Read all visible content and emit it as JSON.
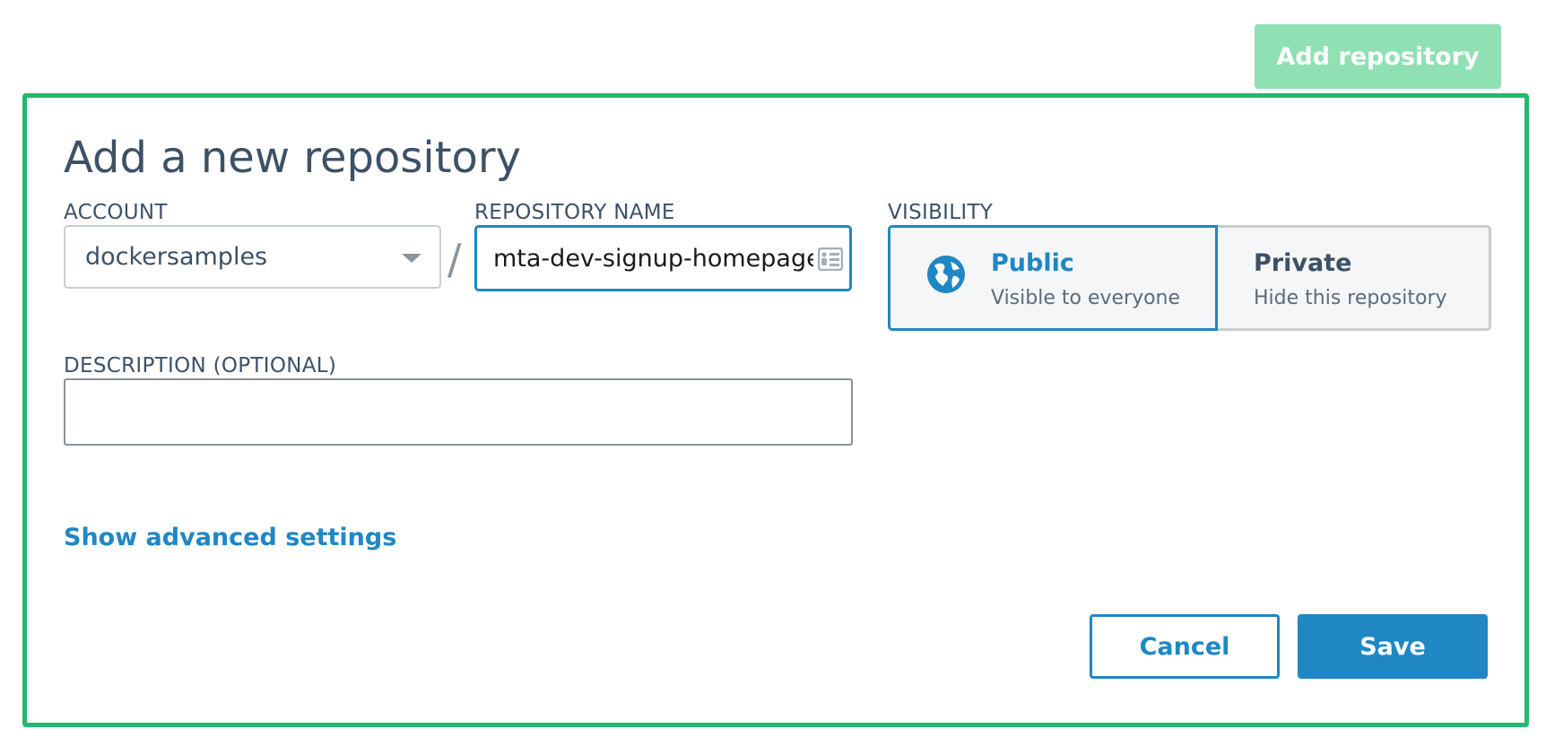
{
  "header": {
    "add_repository_label": "Add repository"
  },
  "form": {
    "title": "Add a new repository",
    "account": {
      "label": "ACCOUNT",
      "selected": "dockersamples"
    },
    "separator": "/",
    "repository_name": {
      "label": "REPOSITORY NAME",
      "value": "mta-dev-signup-homepage"
    },
    "visibility": {
      "label": "VISIBILITY",
      "options": [
        {
          "title": "Public",
          "subtitle": "Visible to everyone",
          "selected": true
        },
        {
          "title": "Private",
          "subtitle": "Hide this repository",
          "selected": false
        }
      ]
    },
    "description": {
      "label": "DESCRIPTION (OPTIONAL)",
      "value": ""
    },
    "advanced_link": "Show advanced settings",
    "cancel_label": "Cancel",
    "save_label": "Save"
  },
  "colors": {
    "panel_border": "#23b86d",
    "add_button_bg": "#8fe0b3",
    "accent": "#1f87c4",
    "text": "#3d5166"
  },
  "icons": {
    "account_caret": "chevron-down-icon",
    "autofill": "autofill-icon",
    "public": "globe-icon"
  }
}
